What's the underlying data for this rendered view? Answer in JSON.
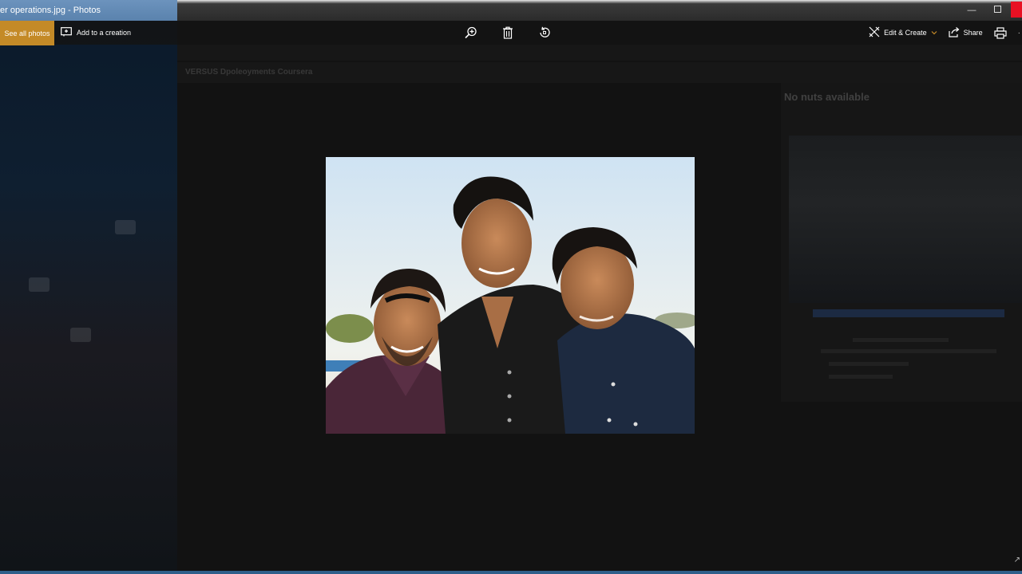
{
  "window": {
    "title": "er operations.jpg - Photos",
    "controls": {
      "minimize_icon": "minimize-icon",
      "maximize_icon": "maximize-icon",
      "close_icon": "close-icon"
    }
  },
  "toolbar": {
    "see_all_label": "See all photos",
    "add_creation_label": "Add to a creation",
    "center_tools": [
      {
        "name": "zoom-in-icon",
        "tooltip": ""
      },
      {
        "name": "delete-icon",
        "tooltip": ""
      },
      {
        "name": "rotate-icon",
        "tooltip": ""
      }
    ],
    "edit_create_label": "Edit & Create",
    "share_label": "Share",
    "print_icon": "print-icon",
    "more_icon": "more-icon"
  },
  "background": {
    "browser_tab_title": "VERSUS Dpoleoyments Coursera",
    "panel_heading": "No nuts available"
  },
  "colors": {
    "accent": "#c48a27",
    "titlebar": "#2b2b2b",
    "canvas": "#121212",
    "close": "#e81123"
  }
}
